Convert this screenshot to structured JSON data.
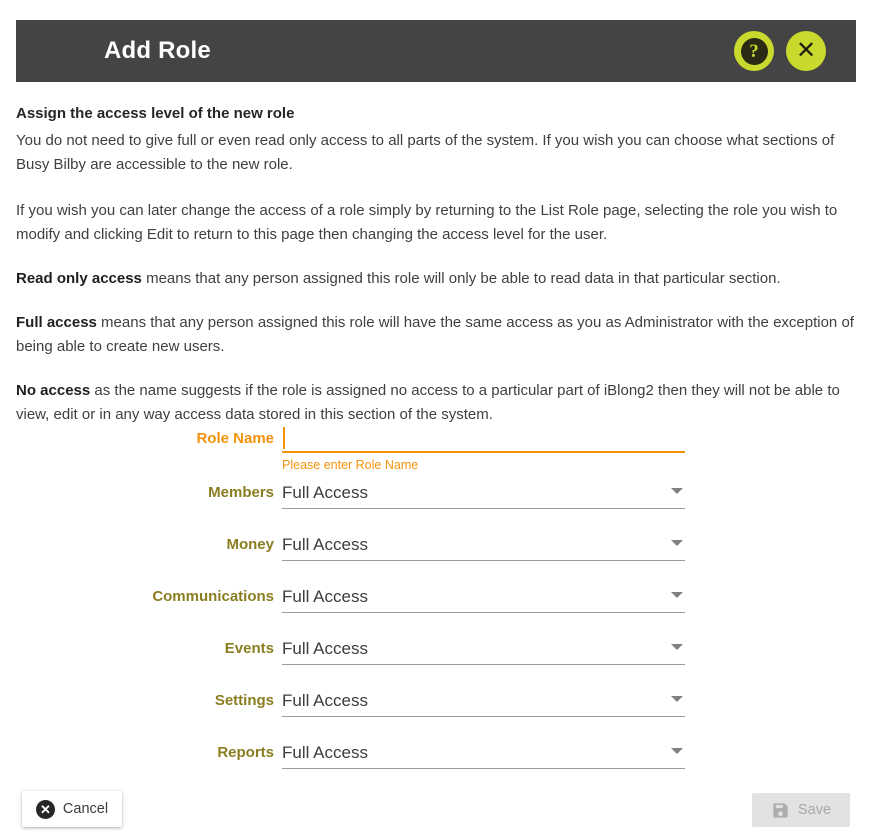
{
  "header": {
    "title": "Add Role",
    "help_button": {
      "icon": "question-mark-icon",
      "label": "?"
    },
    "close_button": {
      "icon": "close-icon",
      "label": "✕"
    },
    "accent_color": "#c9d92e",
    "background_color": "#444444"
  },
  "body": {
    "heading": "Assign the access level of the new role",
    "paragraphs": [
      {
        "bold_lead": "",
        "text": "You do not need to give full or even read only access to all parts of the system. If you wish you can choose what sections of Busy Bilby are accessible to the new role."
      },
      {
        "bold_lead": "",
        "text": "If you wish you can later change the access of a role simply by returning to the List Role page, selecting the role you wish to modify and clicking Edit to return to this page then changing the access level for the user."
      },
      {
        "bold_lead": "Read only access",
        "text": " means that any person assigned this role will only be able to read data in that particular section."
      },
      {
        "bold_lead": "Full access",
        "text": " means that any person assigned this role will have the same access as you as Administrator with the exception of being able to create new users."
      },
      {
        "bold_lead": "No access",
        "text": " as the name suggests if the role is assigned no access to a particular part of iBlong2 then they will not be able to view, edit or in any way access data stored in this section of the system."
      }
    ]
  },
  "form": {
    "role_name": {
      "label": "Role Name",
      "value": "",
      "placeholder": "",
      "error": "Please enter Role Name",
      "error_color": "#f5920b"
    },
    "label_color": "#8a7e21",
    "selects": [
      {
        "label": "Members",
        "value": "Full Access"
      },
      {
        "label": "Money",
        "value": "Full Access"
      },
      {
        "label": "Communications",
        "value": "Full Access"
      },
      {
        "label": "Events",
        "value": "Full Access"
      },
      {
        "label": "Settings",
        "value": "Full Access"
      },
      {
        "label": "Reports",
        "value": "Full Access"
      }
    ]
  },
  "footer": {
    "cancel": {
      "label": "Cancel",
      "icon": "circle-x-icon"
    },
    "save": {
      "label": "Save",
      "icon": "floppy-disk-icon",
      "disabled": true
    }
  }
}
